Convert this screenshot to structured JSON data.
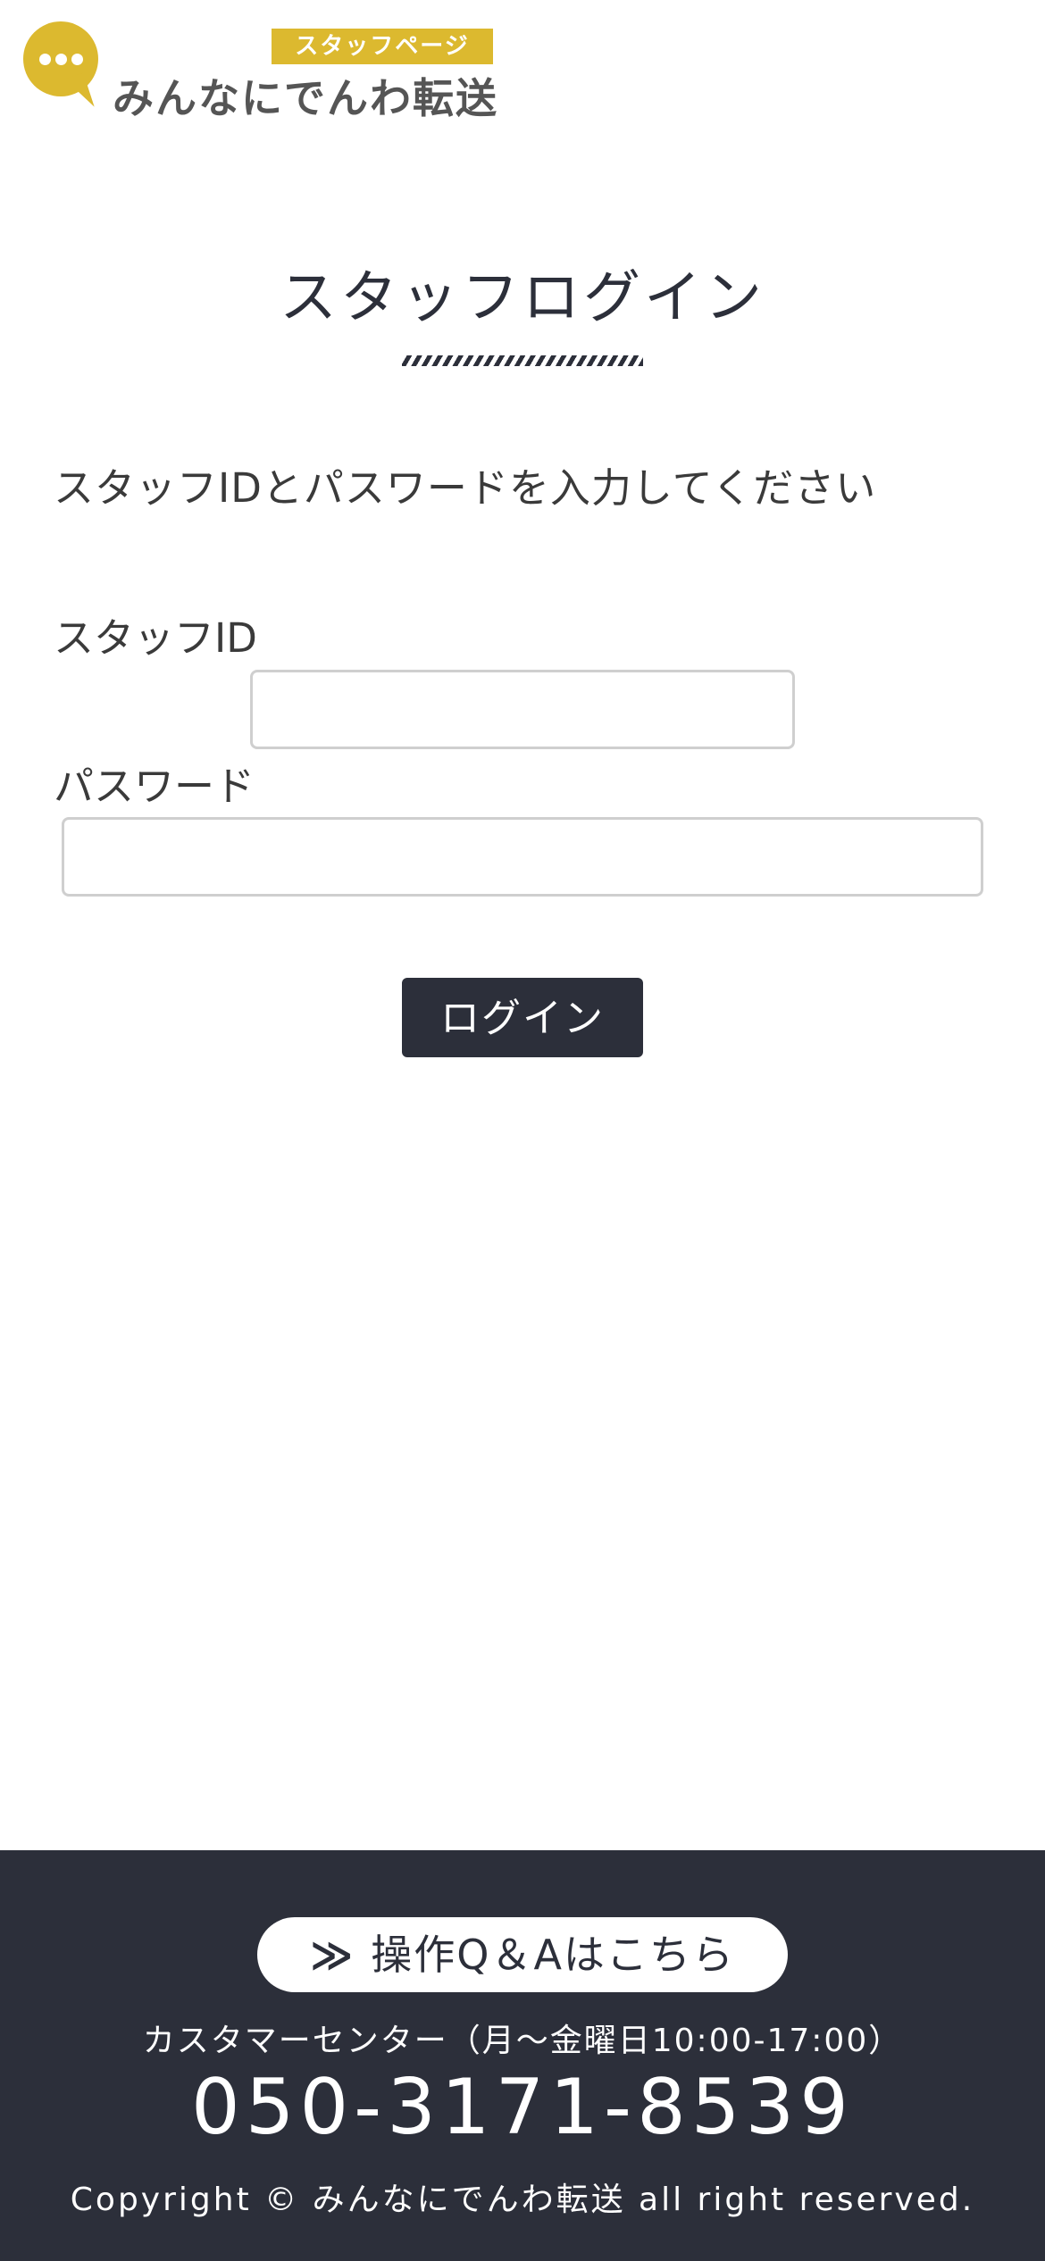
{
  "header": {
    "logo_badge": "スタッフページ",
    "logo_name": "みんなにでんわ転送"
  },
  "main": {
    "title": "スタッフログイン",
    "instruction": "スタッフIDとパスワードを入力してください",
    "staff_id_label": "スタッフID",
    "staff_id_value": "",
    "password_label": "パスワード",
    "password_value": "",
    "login_label": "ログイン"
  },
  "footer": {
    "qa_icon": "≫",
    "qa_label": "操作Q＆Aはこちら",
    "center_label": "カスタマーセンター（月〜金曜日10:00-17:00）",
    "phone": "050-3171-8539",
    "copyright": "Copyright © みんなにでんわ転送 all right reserved."
  },
  "colors": {
    "brand_yellow": "#dcb92f",
    "dark_navy": "#2c2f3a"
  },
  "icons": {
    "logo": "speech-bubble-icon",
    "qa": "double-chevron-right-icon"
  }
}
